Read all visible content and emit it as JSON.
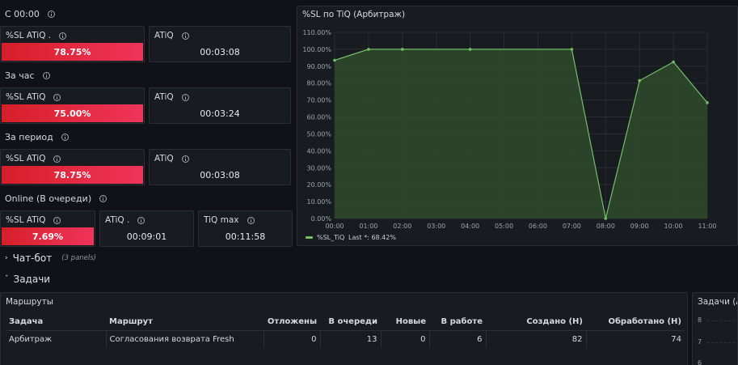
{
  "sections": {
    "since_midnight": "С 00:00",
    "per_hour": "За час",
    "per_period": "За период",
    "online": "Online (В очереди)"
  },
  "stats": {
    "s1_sl_title": "%SL ATiQ .",
    "s1_sl_value": "78.75%",
    "s1_atiq_title": "ATiQ",
    "s1_atiq_value": "00:03:08",
    "s2_sl_title": "%SL ATiQ",
    "s2_sl_value": "75.00%",
    "s2_atiq_title": "ATiQ",
    "s2_atiq_value": "00:03:24",
    "s3_sl_title": "%SL ATiQ",
    "s3_sl_value": "78.75%",
    "s3_atiq_title": "ATiQ",
    "s3_atiq_value": "00:03:08",
    "s4_sl_title": "%SL ATiQ",
    "s4_sl_value": "7.69%",
    "s4_atiq_title": "ATiQ .",
    "s4_atiq_value": "00:09:01",
    "s4_tiq_title": "TiQ max",
    "s4_tiq_value": "00:11:58"
  },
  "chart_panel": {
    "title": "%SL по TiQ (Арбитраж)",
    "legend_name": "%SL_TiQ",
    "legend_last": "Last *: 68.42%"
  },
  "chart_data": {
    "type": "area",
    "x": [
      "00:00",
      "01:00",
      "02:00",
      "03:00",
      "04:00",
      "05:00",
      "06:00",
      "07:00",
      "08:00",
      "09:00",
      "10:00",
      "11:00"
    ],
    "series": [
      {
        "name": "%SL_TiQ",
        "points": [
          [
            0,
            93.5
          ],
          [
            1,
            100
          ],
          [
            2,
            100
          ],
          [
            4,
            100
          ],
          [
            7,
            100
          ],
          [
            8,
            0
          ],
          [
            9,
            81.5
          ],
          [
            10,
            92.5
          ],
          [
            11,
            68.42
          ]
        ]
      }
    ],
    "y_ticks": [
      "0.00%",
      "10.00%",
      "20.00%",
      "30.00%",
      "40.00%",
      "50.00%",
      "60.00%",
      "70.00%",
      "80.00%",
      "90.00%",
      "100.00%",
      "110.00%"
    ],
    "ylim": [
      0,
      110
    ],
    "grid": true,
    "legend": "bottom-left",
    "colors": {
      "line": "#73bf69",
      "fill": "#2e4a2b"
    }
  },
  "rows": {
    "chatbot_label": "Чат-бот",
    "chatbot_sub": "(3 panels)",
    "tasks_label": "Задачи"
  },
  "routes_panel": {
    "title": "Маршруты",
    "headers": [
      "Задача",
      "Маршрут",
      "Отложены",
      "В очереди",
      "Новые",
      "В работе",
      "Создано (Н)",
      "Обработано (Н)"
    ],
    "row": [
      "Арбитраж",
      "Согласования возврата Fresh",
      "0",
      "13",
      "0",
      "6",
      "82",
      "74"
    ]
  },
  "right_panel": {
    "title": "Задачи (Ар",
    "ticks": [
      "8",
      "7",
      "6"
    ]
  }
}
